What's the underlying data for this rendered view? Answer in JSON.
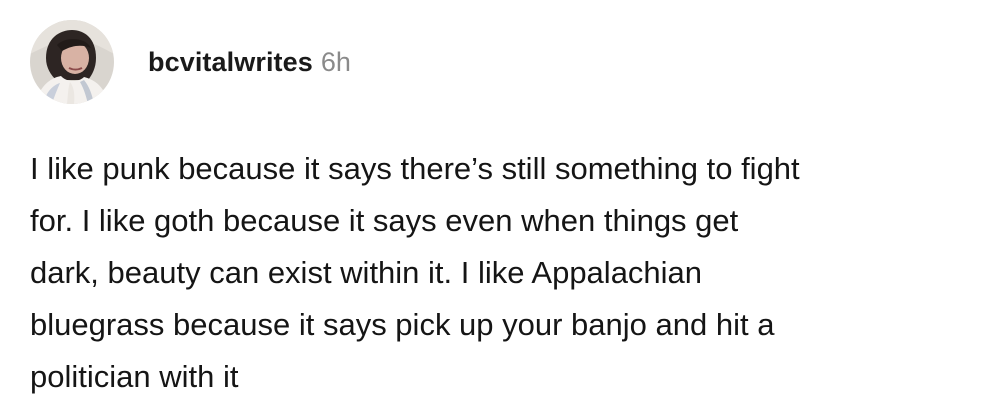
{
  "post": {
    "avatar_icon": "profile-photo",
    "username": "bcvitalwrites",
    "timestamp": "6h",
    "lines": [
      "I like punk because it says there’s still something to fight",
      "for. I like goth because it says even when things get",
      "dark, beauty can exist within it. I like Appalachian",
      "bluegrass because it says pick up your banjo and hit a",
      "politician with it"
    ]
  }
}
